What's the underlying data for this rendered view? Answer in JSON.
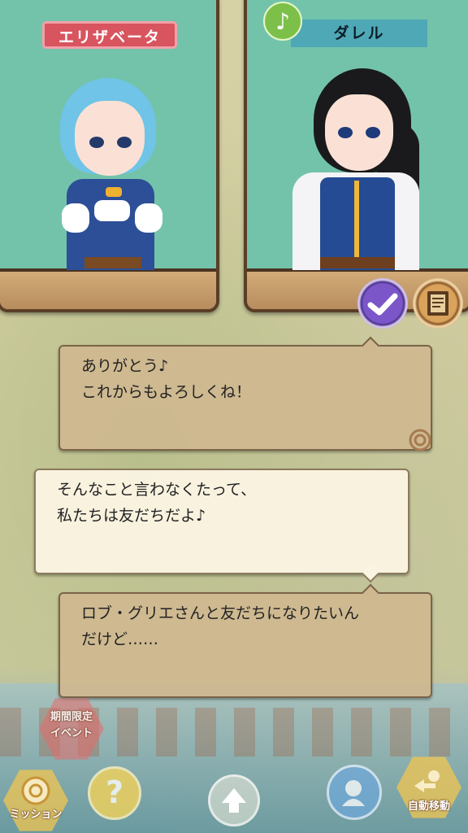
{
  "characters": {
    "left": {
      "name": "エリザベータ"
    },
    "right": {
      "name": "ダレル",
      "badge": "♪"
    }
  },
  "dialogue": [
    {
      "lines": [
        "ありがとう♪",
        "これからもよろしくね！"
      ],
      "style": "tan"
    },
    {
      "lines": [
        "そんなこと言わなくたって、",
        "私たちは友だちだよ♪"
      ],
      "style": "cream"
    },
    {
      "lines": [
        "ロブ・グリエさんと友だちになりたいん",
        "だけど……"
      ],
      "style": "tan"
    }
  ],
  "hud": {
    "event_label": "期間限定\nイベント",
    "mission_label": "ミッション",
    "help_symbol": "?",
    "auto_move_label": "自動移動"
  },
  "colors": {
    "panel_screen": "#73c3ab",
    "panel_wood": "#c39a6a",
    "name_pink": "#d8545f",
    "name_teal": "#4fa8b6",
    "bubble_tan": "#cfb890",
    "bubble_cream": "#faf4e2"
  },
  "icons": [
    "music-note-icon",
    "checkmark-icon",
    "notice-board-icon",
    "spiral-icon",
    "mission-icon",
    "help-icon",
    "arrow-up-icon",
    "character-switch-icon",
    "auto-move-icon"
  ]
}
